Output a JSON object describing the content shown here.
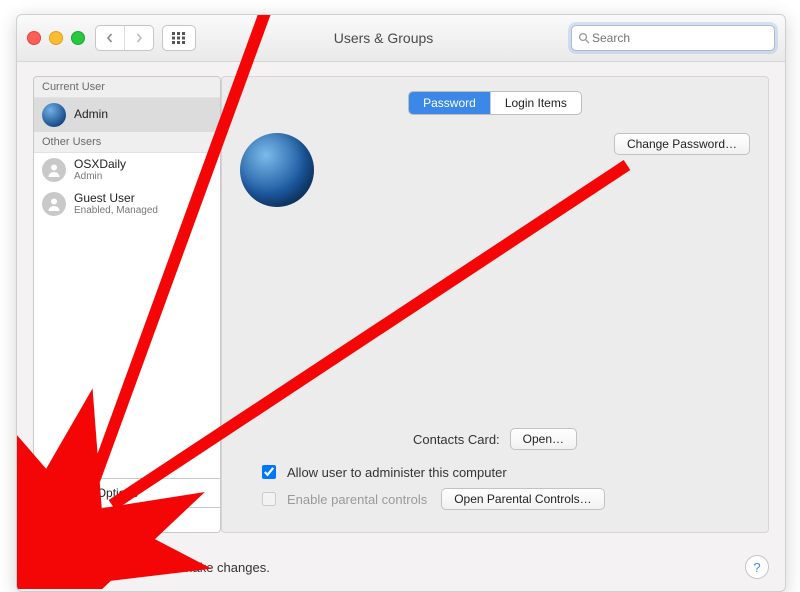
{
  "window": {
    "title": "Users & Groups"
  },
  "search": {
    "placeholder": "Search"
  },
  "sidebar": {
    "section_current": "Current User",
    "section_other": "Other Users",
    "current": {
      "name": "Admin"
    },
    "others": [
      {
        "name": "OSXDaily",
        "sub": "Admin"
      },
      {
        "name": "Guest User",
        "sub": "Enabled, Managed"
      }
    ],
    "login_options": "Login Options"
  },
  "tabs": {
    "password": "Password",
    "login_items": "Login Items"
  },
  "main": {
    "change_password": "Change Password…",
    "contacts_label": "Contacts Card:",
    "open": "Open…",
    "admin_check": "Allow user to administer this computer",
    "parental_check": "Enable parental controls",
    "open_parental": "Open Parental Controls…"
  },
  "footer": {
    "text": "Click the lock to make changes.",
    "help": "?"
  },
  "colors": {
    "annotation": "#f40606",
    "tab_active": "#3b88e9"
  }
}
